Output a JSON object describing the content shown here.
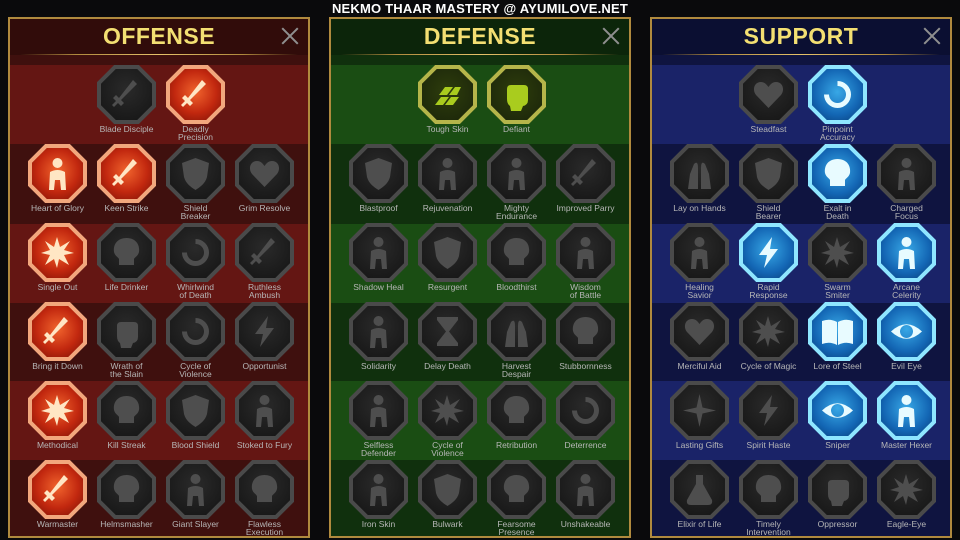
{
  "page_title": "NEKMO THAAR MASTERY @ AYUMILOVE.NET",
  "panels": {
    "offense": {
      "title": "OFFENSE",
      "skills": [
        {
          "label": "Blade Disciple",
          "state": "inactive",
          "icon": "crossed-swords-icon"
        },
        {
          "label": "Deadly\nPrecision",
          "state": "active",
          "icon": "dagger-icon"
        },
        {
          "label": "Heart of Glory",
          "state": "active",
          "icon": "horned-figure-icon"
        },
        {
          "label": "Keen Strike",
          "state": "active",
          "icon": "slashing-sword-icon"
        },
        {
          "label": "Shield\nBreaker",
          "state": "inactive",
          "icon": "broken-shield-icon"
        },
        {
          "label": "Grim Resolve",
          "state": "inactive",
          "icon": "cracked-heart-icon"
        },
        {
          "label": "Single Out",
          "state": "active",
          "icon": "arrows-target-icon"
        },
        {
          "label": "Life Drinker",
          "state": "inactive",
          "icon": "fangs-icon"
        },
        {
          "label": "Whirlwind\nof Death",
          "state": "inactive",
          "icon": "whirlwind-icon"
        },
        {
          "label": "Ruthless\nAmbush",
          "state": "inactive",
          "icon": "ambush-blade-icon"
        },
        {
          "label": "Bring it Down",
          "state": "active",
          "icon": "sword-down-icon"
        },
        {
          "label": "Wrath of\nthe Slain",
          "state": "inactive",
          "icon": "raised-fist-icon"
        },
        {
          "label": "Cycle of\nViolence",
          "state": "inactive",
          "icon": "spinning-axe-icon"
        },
        {
          "label": "Opportunist",
          "state": "inactive",
          "icon": "chain-lightning-icon"
        },
        {
          "label": "Methodical",
          "state": "active",
          "icon": "burst-target-icon"
        },
        {
          "label": "Kill Streak",
          "state": "inactive",
          "icon": "skull-icon"
        },
        {
          "label": "Blood Shield",
          "state": "inactive",
          "icon": "sword-in-shield-icon"
        },
        {
          "label": "Stoked to Fury",
          "state": "inactive",
          "icon": "raging-figure-icon"
        },
        {
          "label": "Warmaster",
          "state": "active",
          "icon": "sword-strike-icon"
        },
        {
          "label": "Helmsmasher",
          "state": "inactive",
          "icon": "helmet-icon"
        },
        {
          "label": "Giant Slayer",
          "state": "inactive",
          "icon": "giant-icon"
        },
        {
          "label": "Flawless\nExecution",
          "state": "inactive",
          "icon": "executioner-skull-icon"
        }
      ]
    },
    "defense": {
      "title": "DEFENSE",
      "skills": [
        {
          "label": "Tough Skin",
          "state": "active",
          "icon": "scale-plates-icon"
        },
        {
          "label": "Defiant",
          "state": "active",
          "icon": "clenched-fist-icon"
        },
        {
          "label": "Blastproof",
          "state": "inactive",
          "icon": "layered-shield-icon"
        },
        {
          "label": "Rejuvenation",
          "state": "inactive",
          "icon": "healing-hand-icon"
        },
        {
          "label": "Mighty\nEndurance",
          "state": "inactive",
          "icon": "muscular-torso-icon"
        },
        {
          "label": "Improved Parry",
          "state": "inactive",
          "icon": "parry-blades-icon"
        },
        {
          "label": "Shadow Heal",
          "state": "inactive",
          "icon": "shadow-figure-icon"
        },
        {
          "label": "Resurgent",
          "state": "inactive",
          "icon": "sword-and-shield-icon"
        },
        {
          "label": "Bloodthirst",
          "state": "inactive",
          "icon": "heart-skull-icon"
        },
        {
          "label": "Wisdom\nof Battle",
          "state": "inactive",
          "icon": "meditating-figure-icon"
        },
        {
          "label": "Solidarity",
          "state": "inactive",
          "icon": "crowd-icon"
        },
        {
          "label": "Delay Death",
          "state": "inactive",
          "icon": "hourglass-icon"
        },
        {
          "label": "Harvest\nDespair",
          "state": "inactive",
          "icon": "open-palm-icon"
        },
        {
          "label": "Stubbornness",
          "state": "inactive",
          "icon": "bull-skull-icon"
        },
        {
          "label": "Selfless\nDefender",
          "state": "inactive",
          "icon": "running-defender-icon"
        },
        {
          "label": "Cycle of\nViolence",
          "state": "inactive",
          "icon": "blood-drops-icon"
        },
        {
          "label": "Retribution",
          "state": "inactive",
          "icon": "flaming-skull-icon"
        },
        {
          "label": "Deterrence",
          "state": "inactive",
          "icon": "deflection-icon"
        },
        {
          "label": "Iron Skin",
          "state": "inactive",
          "icon": "armored-figure-icon"
        },
        {
          "label": "Bulwark",
          "state": "inactive",
          "icon": "tower-shield-icon"
        },
        {
          "label": "Fearsome\nPresence",
          "state": "inactive",
          "icon": "demon-face-icon"
        },
        {
          "label": "Unshakeable",
          "state": "inactive",
          "icon": "standing-figure-icon"
        }
      ]
    },
    "support": {
      "title": "SUPPORT",
      "skills": [
        {
          "label": "Steadfast",
          "state": "inactive",
          "icon": "heart-sparkle-icon"
        },
        {
          "label": "Pinpoint\nAccuracy",
          "state": "active",
          "icon": "target-slash-icon"
        },
        {
          "label": "Lay on Hands",
          "state": "inactive",
          "icon": "praying-hands-icon"
        },
        {
          "label": "Shield\nBearer",
          "state": "inactive",
          "icon": "shield-aura-icon"
        },
        {
          "label": "Exalt in\nDeath",
          "state": "active",
          "icon": "blue-flame-skull-icon"
        },
        {
          "label": "Charged\nFocus",
          "state": "inactive",
          "icon": "charged-arrow-icon"
        },
        {
          "label": "Healing\nSavior",
          "state": "inactive",
          "icon": "healer-figure-icon"
        },
        {
          "label": "Rapid\nResponse",
          "state": "active",
          "icon": "lightning-icon"
        },
        {
          "label": "Swarm\nSmiter",
          "state": "inactive",
          "icon": "swarm-icon"
        },
        {
          "label": "Arcane\nCelerity",
          "state": "active",
          "icon": "afterimage-figure-icon"
        },
        {
          "label": "Merciful Aid",
          "state": "inactive",
          "icon": "chained-heart-icon"
        },
        {
          "label": "Cycle of Magic",
          "state": "inactive",
          "icon": "comet-icon"
        },
        {
          "label": "Lore of Steel",
          "state": "active",
          "icon": "open-book-icon"
        },
        {
          "label": "Evil Eye",
          "state": "active",
          "icon": "radiant-eye-icon"
        },
        {
          "label": "Lasting Gifts",
          "state": "inactive",
          "icon": "compass-star-icon"
        },
        {
          "label": "Spirit Haste",
          "state": "inactive",
          "icon": "winged-boot-icon"
        },
        {
          "label": "Sniper",
          "state": "active",
          "icon": "eye-icon"
        },
        {
          "label": "Master Hexer",
          "state": "active",
          "icon": "hex-figure-icon"
        },
        {
          "label": "Elixir of Life",
          "state": "inactive",
          "icon": "potion-flask-icon"
        },
        {
          "label": "Timely\nIntervention",
          "state": "inactive",
          "icon": "shrouded-skull-icon"
        },
        {
          "label": "Oppressor",
          "state": "inactive",
          "icon": "crushing-fist-icon"
        },
        {
          "label": "Eagle-Eye",
          "state": "inactive",
          "icon": "eagle-icon"
        }
      ]
    }
  },
  "colors": {
    "title_gold": "#f3df72",
    "panel_border": "#b08a3e",
    "offense_bg": "#641613",
    "defense_bg": "#1a4d13",
    "support_bg": "#1a2368",
    "label_grey": "#b7b7b7"
  }
}
